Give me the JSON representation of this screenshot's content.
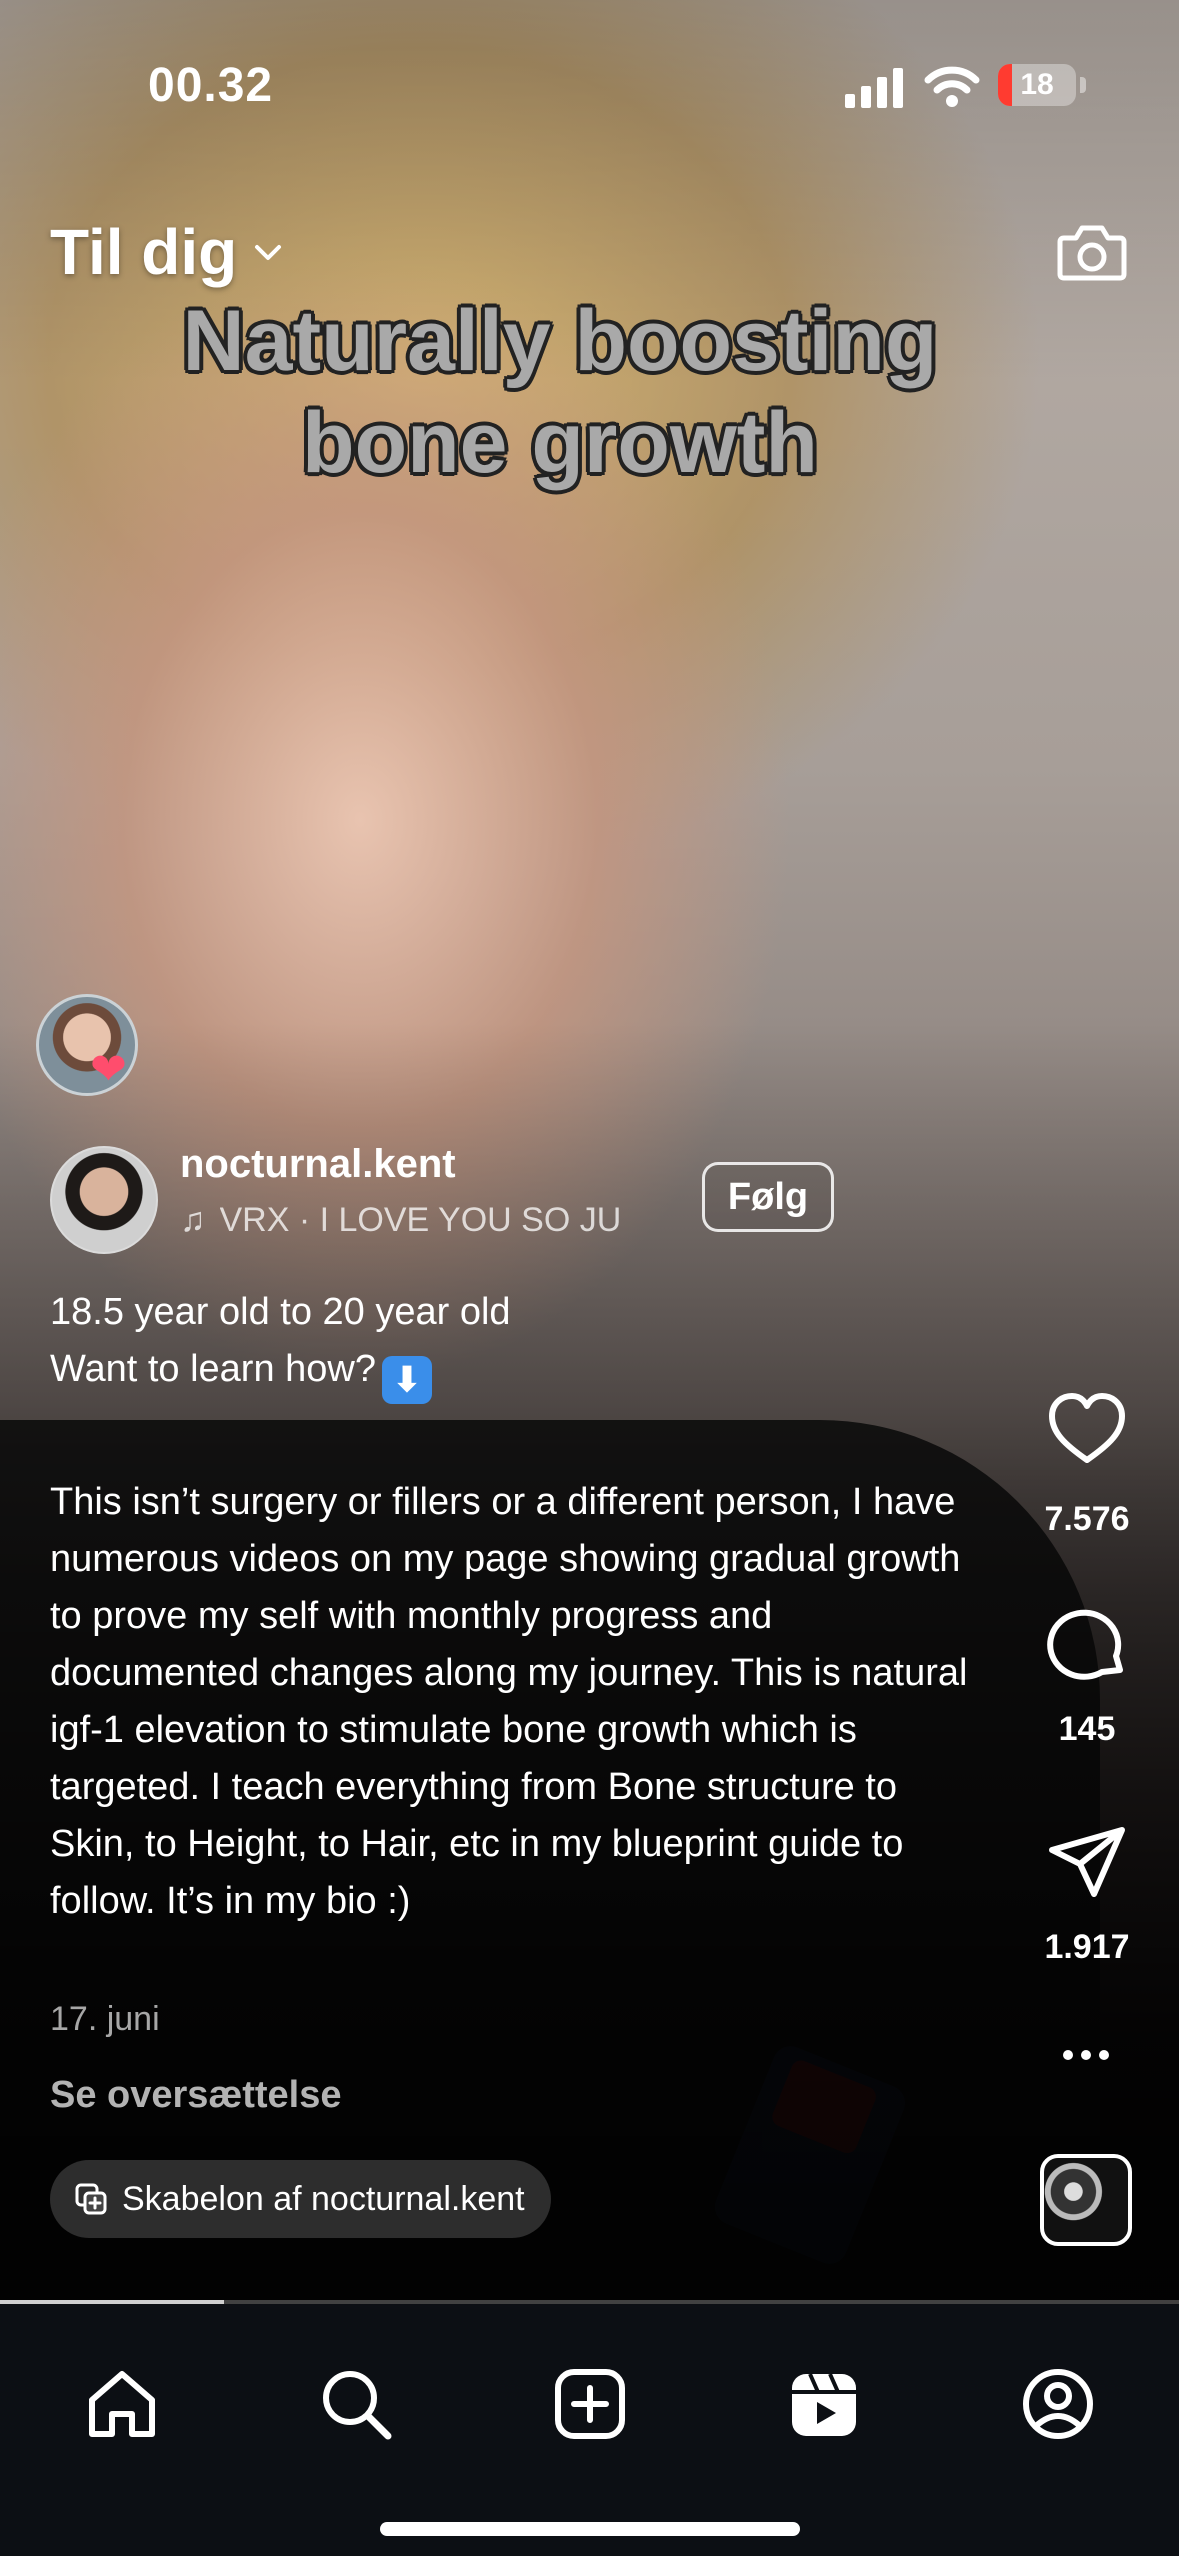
{
  "status_bar": {
    "time": "00.32",
    "battery_level": "18",
    "battery_fraction": 0.18
  },
  "header": {
    "feed_title": "Til dig",
    "camera_icon": "camera-icon"
  },
  "video": {
    "overlay_text": "Naturally boosting bone growth",
    "playback_progress": 0.19
  },
  "post": {
    "username": "nocturnal.kent",
    "music": "VRX · I LOVE YOU SO JU",
    "follow_label": "Følg",
    "caption_line1": "18.5 year old to 20 year old",
    "caption_line2": "Want to learn how?",
    "caption_emoji": "⬇",
    "caption_body": "This isn’t surgery or fillers or a different person, I have numerous videos on my page showing gradual growth to prove my self with monthly progress and documented changes along my journey. This is natural igf-1 elevation to stimulate bone growth which is targeted. I teach everything from Bone structure to Skin, to Height, to Hair, etc in my blueprint guide to follow. It’s in my bio :)",
    "date": "17. juni",
    "translate_label": "Se oversættelse",
    "template_label": "Skabelon af nocturnal.kent"
  },
  "actions": {
    "likes": "7.576",
    "comments": "145",
    "shares": "1.917"
  },
  "nav": {
    "items": [
      "home-icon",
      "search-icon",
      "create-icon",
      "reels-icon",
      "profile-icon"
    ]
  },
  "colors": {
    "battery_low": "#ff3b30",
    "nav_background": "#0c0f14",
    "liked_heart": "#ff4d6d"
  }
}
